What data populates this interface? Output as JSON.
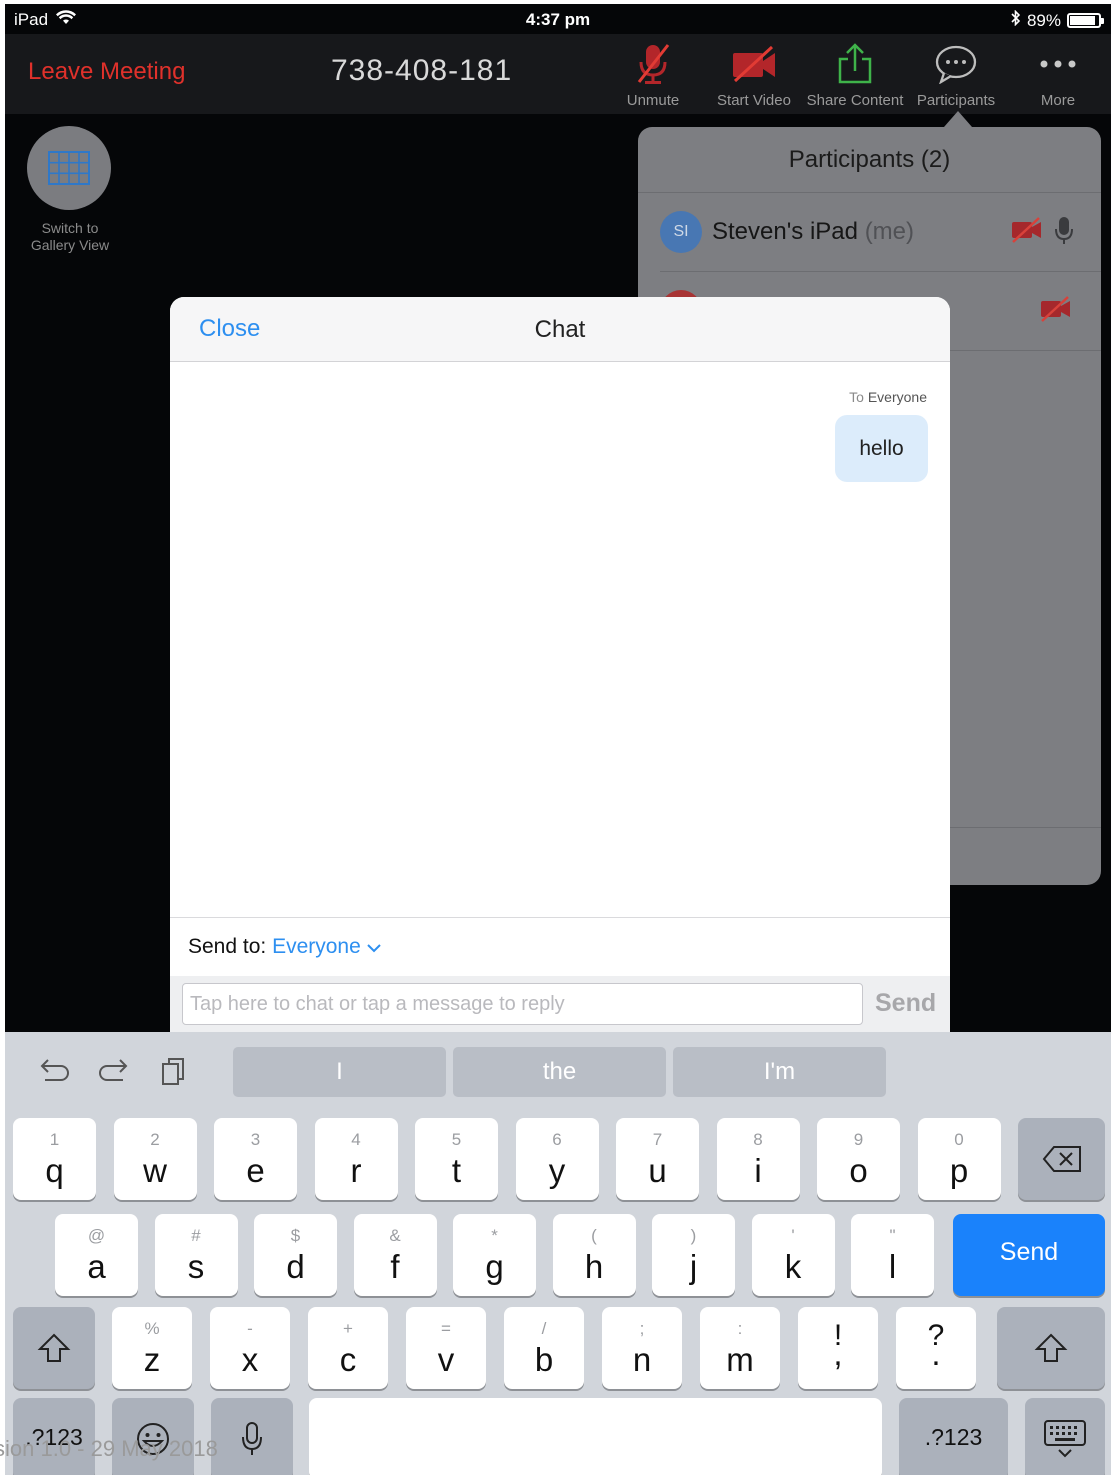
{
  "status_bar": {
    "device": "iPad",
    "time": "4:37 pm",
    "battery": "89%",
    "battery_level": 0.89
  },
  "toolbar": {
    "leave_label": "Leave Meeting",
    "meeting_id": "738-408-181",
    "unmute_label": "Unmute",
    "start_video_label": "Start Video",
    "share_content_label": "Share Content",
    "participants_label": "Participants",
    "more_label": "More"
  },
  "gallery": {
    "line1": "Switch to",
    "line2": "Gallery View"
  },
  "participants_panel": {
    "title": "Participants (2)",
    "rows": [
      {
        "initials": "SI",
        "name": "Steven's iPad",
        "tag": "(me)"
      }
    ]
  },
  "chat": {
    "close_label": "Close",
    "title": "Chat",
    "messages": [
      {
        "recipient_prefix": "To",
        "recipient": "Everyone",
        "text": "hello"
      }
    ],
    "send_to_label": "Send to:",
    "send_to_value": "Everyone",
    "input_placeholder": "Tap here to chat or tap a message to reply",
    "send_label": "Send"
  },
  "keyboard": {
    "suggestions": [
      "I",
      "the",
      "I'm"
    ],
    "row1": [
      {
        "hint": "1",
        "key": "q"
      },
      {
        "hint": "2",
        "key": "w"
      },
      {
        "hint": "3",
        "key": "e"
      },
      {
        "hint": "4",
        "key": "r"
      },
      {
        "hint": "5",
        "key": "t"
      },
      {
        "hint": "6",
        "key": "y"
      },
      {
        "hint": "7",
        "key": "u"
      },
      {
        "hint": "8",
        "key": "i"
      },
      {
        "hint": "9",
        "key": "o"
      },
      {
        "hint": "0",
        "key": "p"
      }
    ],
    "row2": [
      {
        "hint": "@",
        "key": "a"
      },
      {
        "hint": "#",
        "key": "s"
      },
      {
        "hint": "$",
        "key": "d"
      },
      {
        "hint": "&",
        "key": "f"
      },
      {
        "hint": "*",
        "key": "g"
      },
      {
        "hint": "(",
        "key": "h"
      },
      {
        "hint": ")",
        "key": "j"
      },
      {
        "hint": "'",
        "key": "k"
      },
      {
        "hint": "\"",
        "key": "l"
      }
    ],
    "row3": [
      {
        "hint": "%",
        "key": "z"
      },
      {
        "hint": "-",
        "key": "x"
      },
      {
        "hint": "+",
        "key": "c"
      },
      {
        "hint": "=",
        "key": "v"
      },
      {
        "hint": "/",
        "key": "b"
      },
      {
        "hint": ";",
        "key": "n"
      },
      {
        "hint": ":",
        "key": "m"
      },
      {
        "hint": "!",
        "key": ","
      },
      {
        "hint": "?",
        "key": "."
      }
    ],
    "send_label": "Send",
    "numbers_label": ".?123"
  },
  "footer": {
    "text": "sion 1.0 - 29 May 2018"
  },
  "colors": {
    "leave_red": "#e0312b",
    "accent_blue": "#2d8ff0",
    "keyboard_send_blue": "#1a82fb",
    "share_green": "#3fb34a"
  }
}
